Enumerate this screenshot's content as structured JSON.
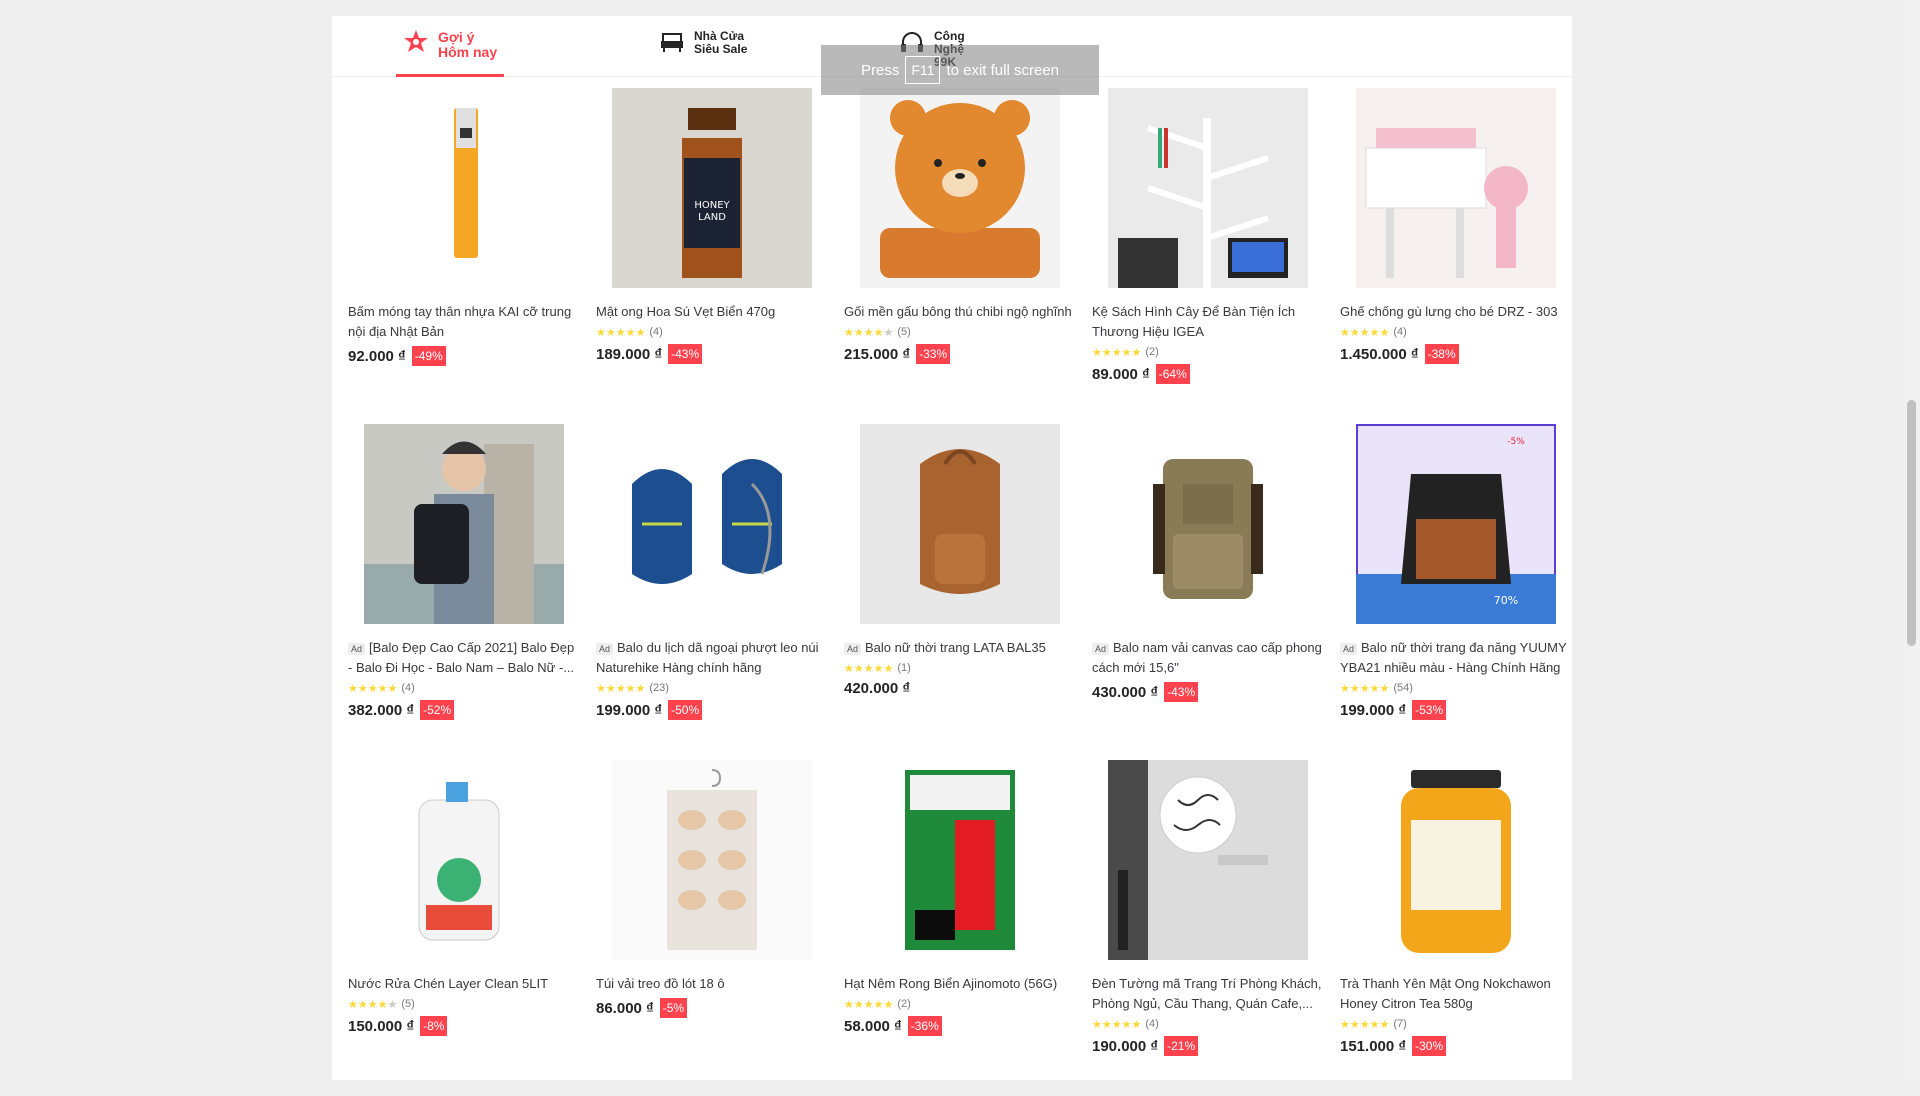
{
  "tabs": [
    {
      "label": "Gợi ý\nHôm nay",
      "icon": "star-badge-icon",
      "active": true
    },
    {
      "label": "Nhà Cửa\nSiêu Sale",
      "icon": "sofa-icon",
      "active": false
    },
    {
      "label": "Công Nghệ\n99K",
      "icon": "headphones-icon",
      "active": false
    }
  ],
  "fullscreen_notice": {
    "before": "Press",
    "key": "F11",
    "after": "to exit full screen"
  },
  "products": [
    {
      "name": "Bấm móng tay thân nhựa KAI cỡ trung nội địa Nhật Bản",
      "ad": false,
      "stars": 0,
      "reviews": "",
      "price": "92.000 ₫",
      "discount": "-49%",
      "image": "nail-clipper-image"
    },
    {
      "name": "Mật ong Hoa Sú Vẹt Biển 470g",
      "ad": false,
      "stars": 5,
      "reviews": "(4)",
      "price": "189.000 ₫",
      "discount": "-43%",
      "image": "honey-bottle-image"
    },
    {
      "name": "Gối mền gấu bông thú chibi ngộ nghĩnh",
      "ad": false,
      "stars": 4,
      "reviews": "(5)",
      "price": "215.000 ₫",
      "discount": "-33%",
      "image": "bear-pillow-image"
    },
    {
      "name": "Kệ Sách Hình Cây Để Bàn Tiện Ích Thương Hiệu IGEA",
      "ad": false,
      "stars": 5,
      "reviews": "(2)",
      "price": "89.000 ₫",
      "discount": "-64%",
      "image": "tree-bookshelf-image"
    },
    {
      "name": "Ghế chống gù lưng cho bé DRZ - 303",
      "ad": false,
      "stars": 5,
      "reviews": "(4)",
      "price": "1.450.000 ₫",
      "discount": "-38%",
      "image": "kids-desk-image"
    },
    {
      "name": "[Balo Đẹp Cao Cấp 2021] Balo Đẹp - Balo Đi Học - Balo Nam – Balo Nữ -...",
      "ad": true,
      "stars": 5,
      "reviews": "(4)",
      "price": "382.000 ₫",
      "discount": "-52%",
      "image": "man-backpack-image"
    },
    {
      "name": "Balo du lịch dã ngoại phượt leo núi Naturehike Hàng chính hãng",
      "ad": true,
      "stars": 5,
      "reviews": "(23)",
      "price": "199.000 ₫",
      "discount": "-50%",
      "image": "blue-backpack-image"
    },
    {
      "name": "Balo nữ thời trang LATA BAL35",
      "ad": true,
      "stars": 5,
      "reviews": "(1)",
      "price": "420.000 ₫",
      "discount": "",
      "image": "leather-backpack-image"
    },
    {
      "name": "Balo nam vải canvas cao cấp phong cách mới 15,6\"",
      "ad": true,
      "stars": 0,
      "reviews": "",
      "price": "430.000 ₫",
      "discount": "-43%",
      "image": "canvas-backpack-image"
    },
    {
      "name": "Balo nữ thời trang đa năng YUUMY YBA21 nhiều màu - Hàng Chính Hãng",
      "ad": true,
      "stars": 5,
      "reviews": "(54)",
      "price": "199.000 ₫",
      "discount": "-53%",
      "image": "promo-backpack-image"
    },
    {
      "name": "Nước Rửa Chén Layer Clean 5LIT",
      "ad": false,
      "stars": 4,
      "reviews": "(5)",
      "price": "150.000 ₫",
      "discount": "-8%",
      "image": "detergent-jug-image"
    },
    {
      "name": "Túi vải treo đồ lót 18 ô",
      "ad": false,
      "stars": 0,
      "reviews": "",
      "price": "86.000 ₫",
      "discount": "-5%",
      "image": "hanging-organizer-image"
    },
    {
      "name": "Hạt Nêm Rong Biển Ajinomoto (56G)",
      "ad": false,
      "stars": 5,
      "reviews": "(2)",
      "price": "58.000 ₫",
      "discount": "-36%",
      "image": "seasoning-pack-image"
    },
    {
      "name": "Đèn Tường mã Trang Trí Phòng Khách, Phòng Ngủ, Cầu Thang, Quán Cafe,...",
      "ad": false,
      "stars": 5,
      "reviews": "(4)",
      "price": "190.000 ₫",
      "discount": "-21%",
      "image": "wall-lamp-image"
    },
    {
      "name": "Trà Thanh Yên Mật Ong Nokchawon Honey Citron Tea 580g",
      "ad": false,
      "stars": 5,
      "reviews": "(7)",
      "price": "151.000 ₫",
      "discount": "-30%",
      "image": "citron-tea-jar-image"
    }
  ],
  "ad_label": "Ad",
  "colors": {
    "accent": "#ff424e",
    "star": "#fdd836"
  }
}
